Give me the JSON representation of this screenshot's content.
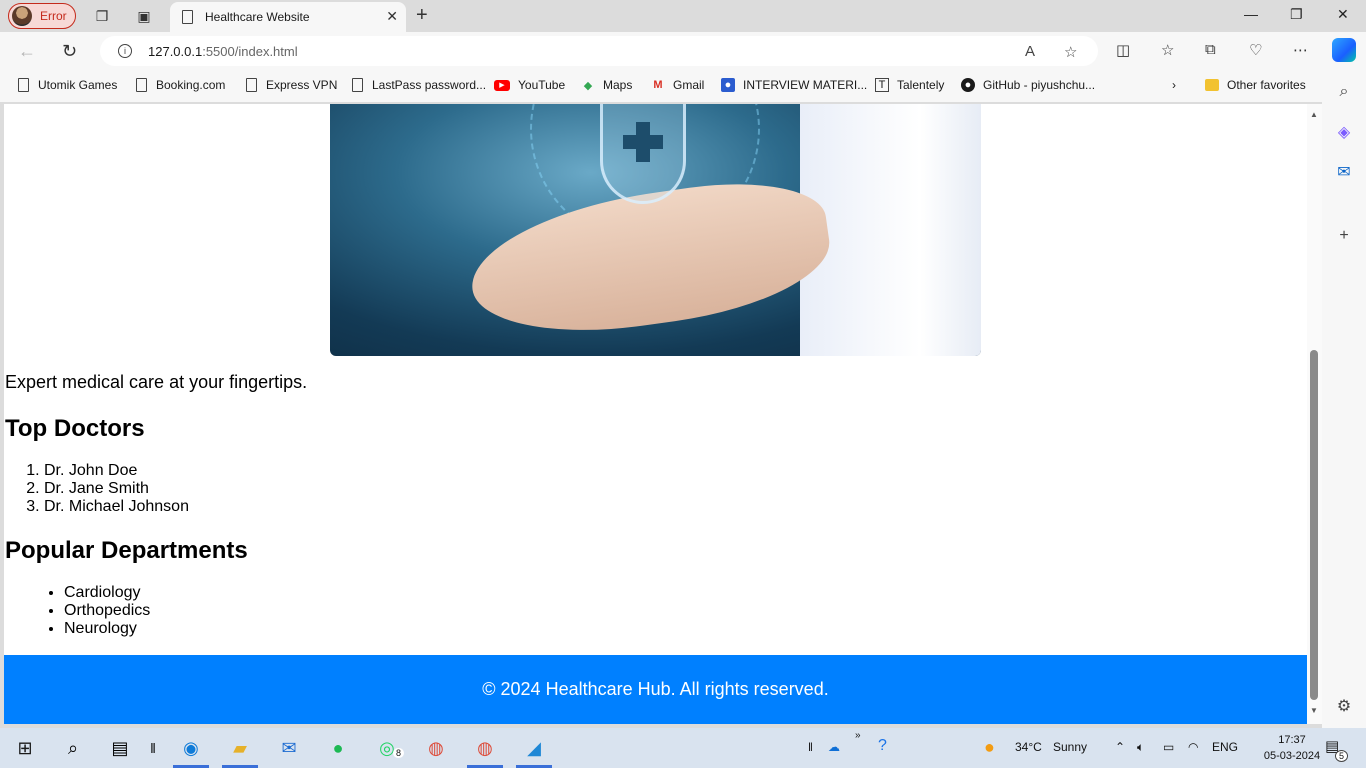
{
  "browser": {
    "profile_label": "Error",
    "tab_title": "Healthcare Website",
    "url_host": "127.0.0.1",
    "url_path": ":5500/index.html",
    "favorites": [
      {
        "label": "Utomik Games",
        "icon": "page-icon"
      },
      {
        "label": "Booking.com",
        "icon": "page-icon"
      },
      {
        "label": "Express VPN",
        "icon": "page-icon"
      },
      {
        "label": "LastPass password...",
        "icon": "page-icon"
      },
      {
        "label": "YouTube",
        "icon": "youtube-icon"
      },
      {
        "label": "Maps",
        "icon": "maps-icon"
      },
      {
        "label": "Gmail",
        "icon": "gmail-icon"
      },
      {
        "label": "INTERVIEW MATERI...",
        "icon": "contact-icon"
      },
      {
        "label": "Talentely",
        "icon": "t-icon"
      },
      {
        "label": "GitHub - piyushchu...",
        "icon": "github-icon"
      }
    ],
    "other_favorites": "Other favorites"
  },
  "page": {
    "tagline": "Expert medical care at your fingertips.",
    "doctors_heading": "Top Doctors",
    "doctors": [
      "Dr. John Doe",
      "Dr. Jane Smith",
      "Dr. Michael Johnson"
    ],
    "departments_heading": "Popular Departments",
    "departments": [
      "Cardiology",
      "Orthopedics",
      "Neurology"
    ],
    "footer": "© 2024 Healthcare Hub. All rights reserved."
  },
  "taskbar": {
    "whatsapp_badge": "8",
    "weather_temp": "34°C",
    "weather_text": "Sunny",
    "language": "ENG",
    "time": "17:37",
    "date": "05-03-2024",
    "notification_count": "5"
  },
  "colors": {
    "footer_bg": "#0080ff",
    "error_accent": "#c42b1c"
  }
}
